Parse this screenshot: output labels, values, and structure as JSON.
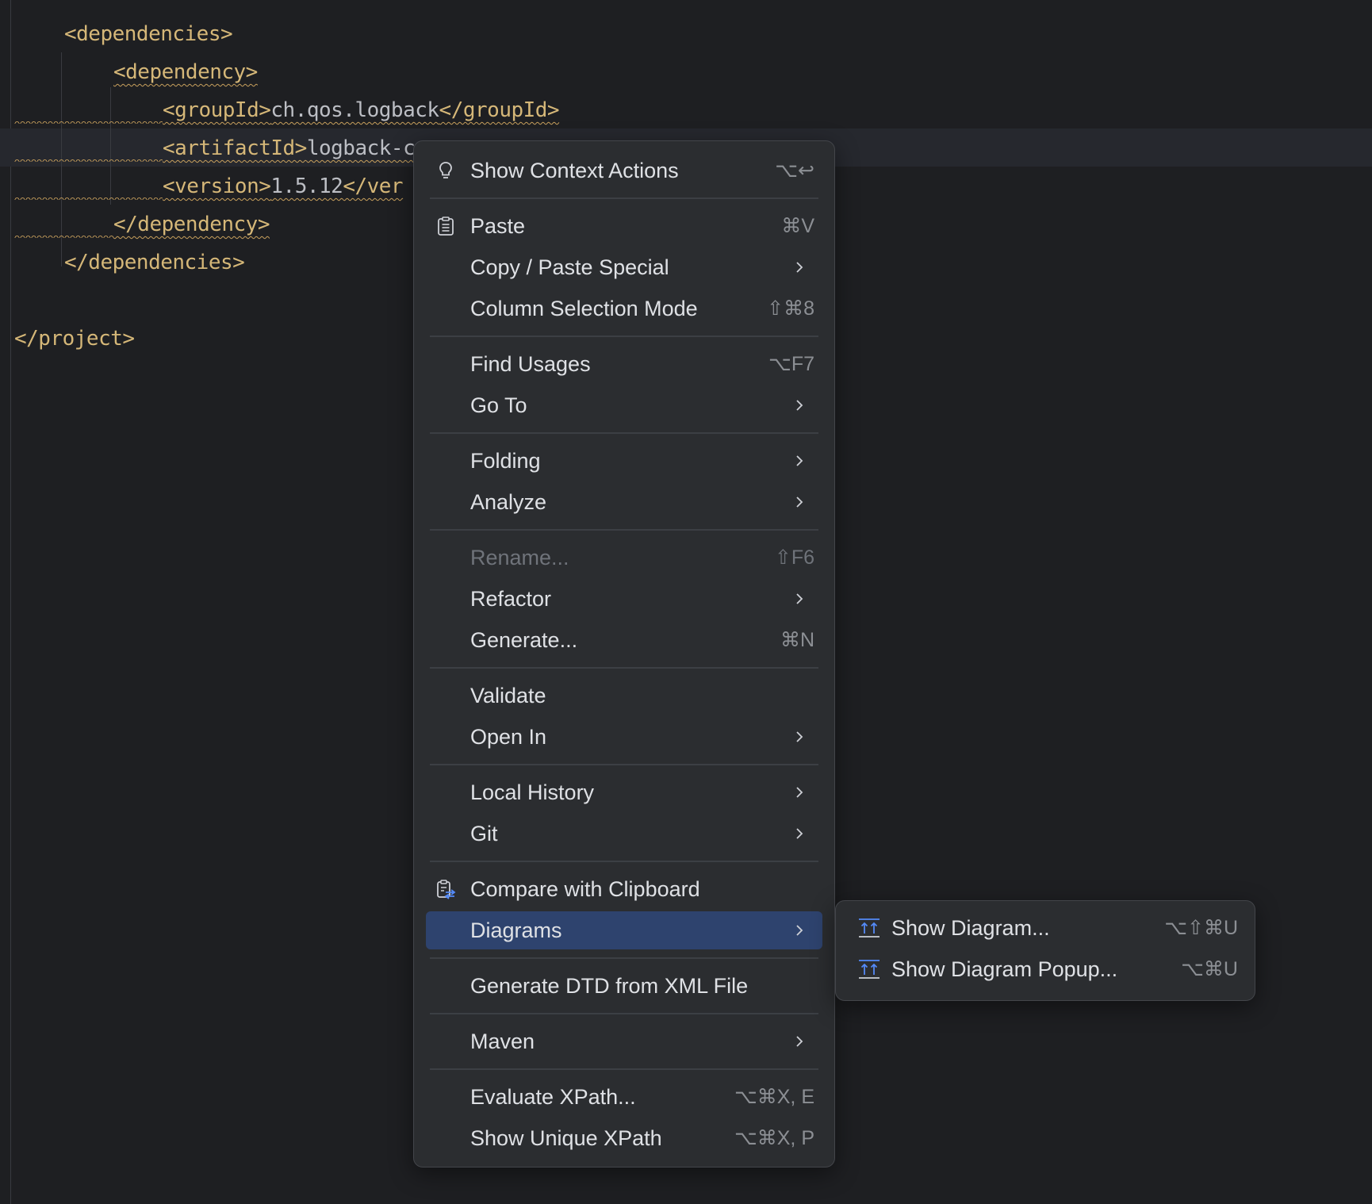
{
  "editor": {
    "lines": [
      {
        "open_tag": "<dependencies>",
        "text": "",
        "close_tag": ""
      },
      {
        "open_tag": "<dependency>",
        "text": "",
        "close_tag": ""
      },
      {
        "open_tag": "<groupId>",
        "text": "ch.qos.logback",
        "close_tag": "</groupId>"
      },
      {
        "open_tag": "<artifactId>",
        "text": "logback-c",
        "close_tag": ""
      },
      {
        "open_tag": "<version>",
        "text": "1.5.12",
        "close_tag": "</ver"
      },
      {
        "open_tag": "</dependency>",
        "text": "",
        "close_tag": ""
      },
      {
        "open_tag": "</dependencies>",
        "text": "",
        "close_tag": ""
      },
      {
        "open_tag": "</project>",
        "text": "",
        "close_tag": ""
      }
    ]
  },
  "context_menu": {
    "items": [
      {
        "label": "Show Context Actions",
        "shortcut": "⌥↩",
        "icon": "lightbulb-icon"
      },
      {
        "label": "Paste",
        "shortcut": "⌘V",
        "icon": "clipboard-icon"
      },
      {
        "label": "Copy / Paste Special",
        "submenu": true
      },
      {
        "label": "Column Selection Mode",
        "shortcut": "⇧⌘8"
      },
      {
        "label": "Find Usages",
        "shortcut": "⌥F7"
      },
      {
        "label": "Go To",
        "submenu": true
      },
      {
        "label": "Folding",
        "submenu": true
      },
      {
        "label": "Analyze",
        "submenu": true
      },
      {
        "label": "Rename...",
        "shortcut": "⇧F6",
        "disabled": true
      },
      {
        "label": "Refactor",
        "submenu": true
      },
      {
        "label": "Generate...",
        "shortcut": "⌘N"
      },
      {
        "label": "Validate"
      },
      {
        "label": "Open In",
        "submenu": true
      },
      {
        "label": "Local History",
        "submenu": true
      },
      {
        "label": "Git",
        "submenu": true
      },
      {
        "label": "Compare with Clipboard",
        "icon": "compare-clipboard-icon"
      },
      {
        "label": "Diagrams",
        "submenu": true,
        "selected": true
      },
      {
        "label": "Generate DTD from XML File"
      },
      {
        "label": "Maven",
        "submenu": true
      },
      {
        "label": "Evaluate XPath...",
        "shortcut": "⌥⌘X, E"
      },
      {
        "label": "Show Unique XPath",
        "shortcut": "⌥⌘X, P"
      }
    ]
  },
  "diagrams_submenu": {
    "items": [
      {
        "label": "Show Diagram...",
        "shortcut": "⌥⇧⌘U",
        "icon": "diagram-icon"
      },
      {
        "label": "Show Diagram Popup...",
        "shortcut": "⌥⌘U",
        "icon": "diagram-icon"
      }
    ]
  },
  "colors": {
    "background": "#1e1f22",
    "menu_background": "#2b2d30",
    "selection": "#2e436e",
    "xml_tag": "#d5b778",
    "text": "#bcbec4"
  }
}
